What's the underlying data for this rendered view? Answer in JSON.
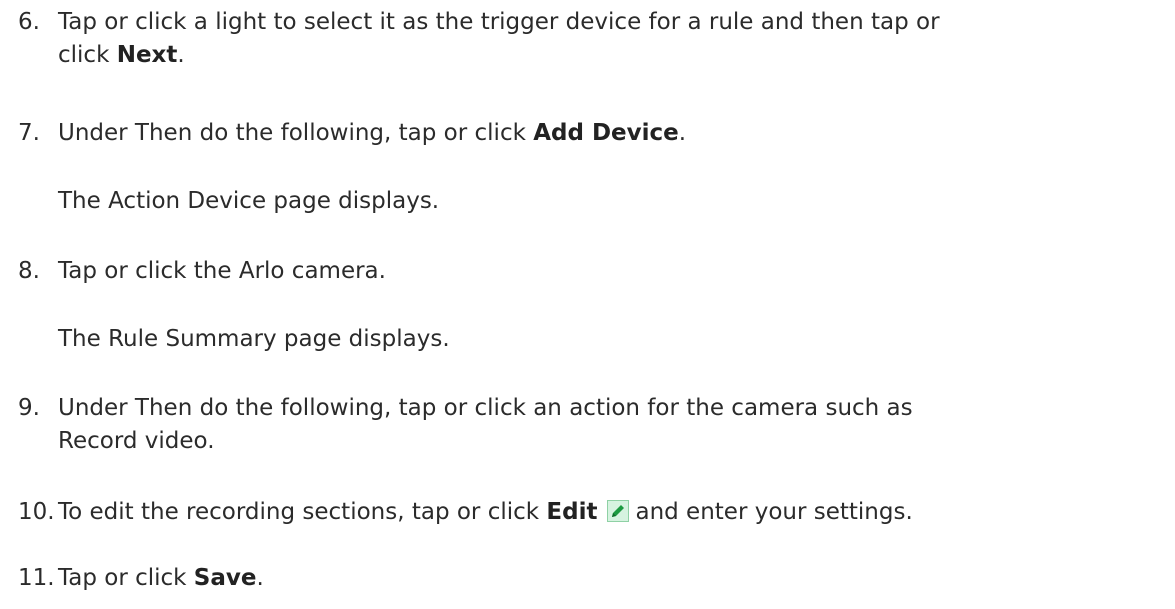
{
  "steps": [
    {
      "num": "6.",
      "text_a": "Tap or click a light to select it as the trigger device for a rule and then tap or",
      "text_b": "click ",
      "bold": "Next",
      "text_c": "."
    },
    {
      "num": "7.",
      "text_a": "Under Then do the following, tap or click ",
      "bold": "Add Device",
      "text_b": "."
    },
    {
      "num": "8.",
      "text_a": "Tap or click the Arlo camera."
    },
    {
      "num": "9.",
      "text_a": "Under Then do the following, tap or click an action for the camera such as",
      "text_b": "Record video."
    },
    {
      "num": "10.",
      "text_a": "To edit the recording sections, tap or click ",
      "bold": "Edit",
      "text_b": "and enter your settings."
    },
    {
      "num": "11.",
      "text_a": "Tap or click ",
      "bold": "Save",
      "text_b": "."
    }
  ],
  "notes": {
    "after_7": "The Action Device page displays.",
    "after_8": "The Rule Summary page displays."
  },
  "icons": {
    "edit": "edit-pencil-icon"
  },
  "colors": {
    "icon_bg": "#d6f3e0",
    "icon_border": "#8fd1a5",
    "pencil": "#1c9a41"
  }
}
